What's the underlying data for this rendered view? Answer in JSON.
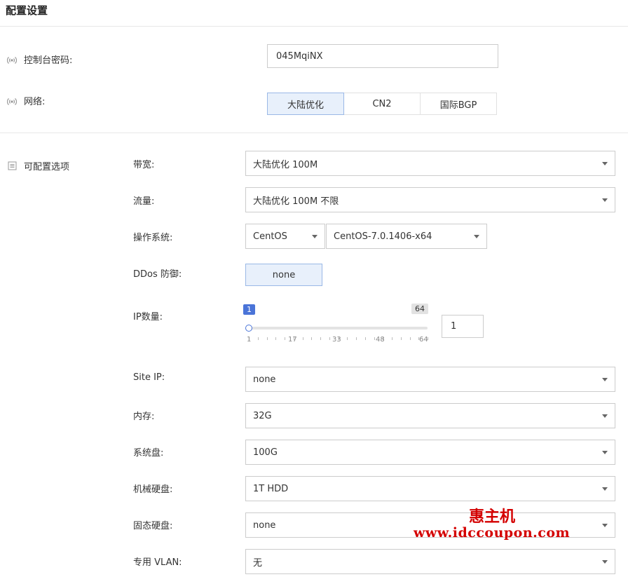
{
  "page": {
    "title": "配置设置"
  },
  "console_password": {
    "label": "控制台密码:",
    "value": "045MqiNX"
  },
  "network": {
    "label": "网络:",
    "options": [
      "大陆优化",
      "CN2",
      "国际BGP"
    ],
    "selected": "大陆优化"
  },
  "options_section": {
    "label": "可配置选项"
  },
  "bandwidth": {
    "label": "带宽:",
    "value": "大陆优化 100M"
  },
  "traffic": {
    "label": "流量:",
    "value": "大陆优化 100M 不限"
  },
  "os": {
    "label": "操作系统:",
    "family": "CentOS",
    "version": "CentOS-7.0.1406-x64"
  },
  "ddos": {
    "label": "DDos 防御:",
    "value": "none"
  },
  "ip_count": {
    "label": "IP数量:",
    "min_badge": "1",
    "max_badge": "64",
    "value": "1",
    "ticks": [
      "1",
      "17",
      "33",
      "48",
      "64"
    ],
    "range_min": 1,
    "range_max": 64,
    "current": 1
  },
  "site_ip": {
    "label": "Site IP:",
    "value": "none"
  },
  "memory": {
    "label": "内存:",
    "value": "32G"
  },
  "system_disk": {
    "label": "系统盘:",
    "value": "100G"
  },
  "hdd": {
    "label": "机械硬盘:",
    "value": "1T HDD"
  },
  "ssd": {
    "label": "固态硬盘:",
    "value": "none"
  },
  "vlan": {
    "label": "专用 VLAN:",
    "value": "无"
  },
  "watermark": {
    "line1": "惠主机",
    "line2": "www.idccoupon.com"
  },
  "colors": {
    "accent": "#4a74d8",
    "active_bg": "#e8f0fb",
    "watermark": "#d40000"
  }
}
